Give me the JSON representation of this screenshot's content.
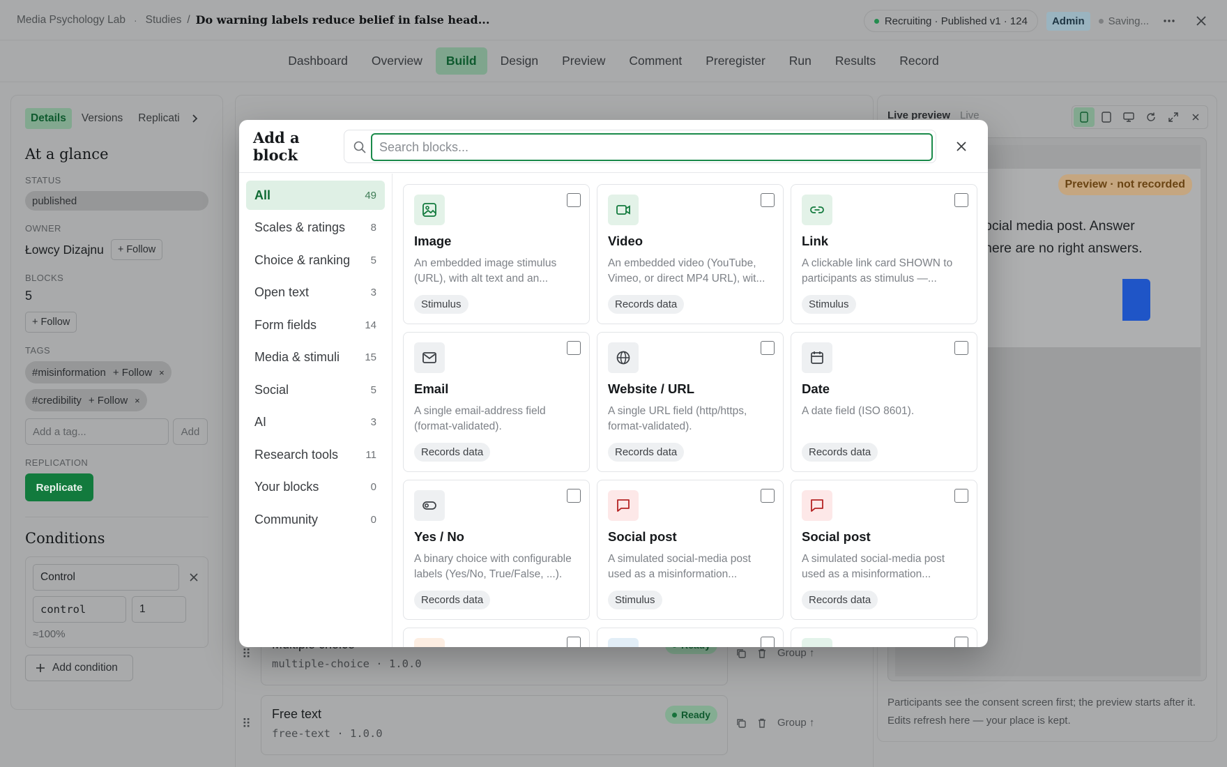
{
  "topbar": {
    "org": "Media Psychology Lab",
    "sep1": "·",
    "studies": "Studies",
    "sep2": "/",
    "title": "Do warning labels reduce belief in false head...",
    "status": "Recruiting · Published v1 · 124",
    "role": "Admin",
    "saving": "Saving..."
  },
  "nav": [
    "Dashboard",
    "Overview",
    "Build",
    "Design",
    "Preview",
    "Comment",
    "Preregister",
    "Run",
    "Results",
    "Record"
  ],
  "left": {
    "tabs": [
      "Details",
      "Versions",
      "Replicati"
    ],
    "glance": "At a glance",
    "status_label": "STATUS",
    "status_value": "published",
    "owner_label": "OWNER",
    "owner": "Łowcy Dizajnu",
    "follow": "+ Follow",
    "blocks_label": "BLOCKS",
    "blocks": "5",
    "tags_label": "TAGS",
    "tags": [
      "#misinformation",
      "#credibility"
    ],
    "tag_x": "×",
    "tag_placeholder": "Add a tag...",
    "add": "Add",
    "replication_label": "REPLICATION",
    "replicate": "Replicate",
    "conditions": "Conditions",
    "cond_name": "Control",
    "cond_key": "control",
    "cond_weight": "1",
    "cond_pct": "≈100%",
    "add_condition": "Add condition"
  },
  "center": {
    "rows": [
      {
        "title": "Multiple choice",
        "sub": "multiple-choice · 1.0.0",
        "status": "Ready"
      },
      {
        "title": "Free text",
        "sub": "free-text · 1.0.0",
        "status": "Ready"
      }
    ],
    "group": "Group ↑"
  },
  "preview": {
    "title": "Live preview",
    "live": "Live",
    "not_recorded": "Preview · not recorded",
    "line1": "ocial media post. Answer",
    "line2": "here are no right answers.",
    "foot": "Participants see the consent screen first; the preview starts after it. Edits refresh here — your place is kept."
  },
  "modal": {
    "title": "Add a block",
    "search_placeholder": "Search blocks...",
    "categories": [
      {
        "label": "All",
        "count": "49"
      },
      {
        "label": "Scales & ratings",
        "count": "8"
      },
      {
        "label": "Choice & ranking",
        "count": "5"
      },
      {
        "label": "Open text",
        "count": "3"
      },
      {
        "label": "Form fields",
        "count": "14"
      },
      {
        "label": "Media & stimuli",
        "count": "15"
      },
      {
        "label": "Social",
        "count": "5"
      },
      {
        "label": "AI",
        "count": "3"
      },
      {
        "label": "Research tools",
        "count": "11"
      },
      {
        "label": "Your blocks",
        "count": "0"
      },
      {
        "label": "Community",
        "count": "0"
      }
    ],
    "cards": [
      {
        "title": "Image",
        "desc": "An embedded image stimulus (URL), with alt text and an...",
        "chip": "Stimulus",
        "icon": "image-icon"
      },
      {
        "title": "Video",
        "desc": "An embedded video (YouTube, Vimeo, or direct MP4 URL), wit...",
        "chip": "Records data",
        "icon": "video-icon"
      },
      {
        "title": "Link",
        "desc": "A clickable link card SHOWN to participants as stimulus —...",
        "chip": "Stimulus",
        "icon": "link-icon"
      },
      {
        "title": "Email",
        "desc": "A single email-address field (format-validated).",
        "chip": "Records data",
        "icon": "mail-icon"
      },
      {
        "title": "Website / URL",
        "desc": "A single URL field (http/https, format-validated).",
        "chip": "Records data",
        "icon": "globe-icon"
      },
      {
        "title": "Date",
        "desc": "A date field (ISO 8601).",
        "chip": "Records data",
        "icon": "calendar-icon"
      },
      {
        "title": "Yes / No",
        "desc": "A binary choice with configurable labels (Yes/No, True/False, ...).",
        "chip": "Records data",
        "icon": "toggle-icon"
      },
      {
        "title": "Social post",
        "desc": "A simulated social-media post used as a misinformation...",
        "chip": "Stimulus",
        "icon": "message-icon"
      },
      {
        "title": "Social post",
        "desc": "A simulated social-media post used as a misinformation...",
        "chip": "Records data",
        "icon": "message-icon"
      }
    ]
  }
}
